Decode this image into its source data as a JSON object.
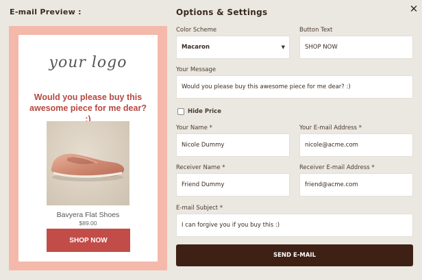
{
  "window": {
    "close_glyph": "✕"
  },
  "preview": {
    "title": "E-mail Preview :",
    "logo_text": "your logo",
    "message": "Would you please buy this awesome piece for me dear? :)",
    "product_name": "Bavyera Flat Shoes",
    "product_price": "$89.00",
    "button_label": "SHOP NOW",
    "button_color": "#c24c48",
    "frame_color": "#f4b9aa"
  },
  "options": {
    "title": "Options & Settings",
    "color_scheme": {
      "label": "Color Scheme",
      "value": "Macaron"
    },
    "button_text": {
      "label": "Button Text",
      "value": "SHOP NOW"
    },
    "message": {
      "label": "Your Message",
      "value": "Would you please buy this awesome piece for me dear? :)"
    },
    "hide_price": {
      "label": "Hide Price",
      "checked": false
    },
    "your_name": {
      "label": "Your Name *",
      "value": "Nicole Dummy"
    },
    "your_email": {
      "label": "Your E-mail Address *",
      "value": "nicole@acme.com"
    },
    "receiver_name": {
      "label": "Receiver Name *",
      "value": "Friend Dummy"
    },
    "receiver_email": {
      "label": "Receiver E-mail Address *",
      "value": "friend@acme.com"
    },
    "subject": {
      "label": "E-mail Subject *",
      "value": "I can forgive you if you buy this :)"
    },
    "send_label": "SEND E-MAIL",
    "send_color": "#3e2114"
  }
}
